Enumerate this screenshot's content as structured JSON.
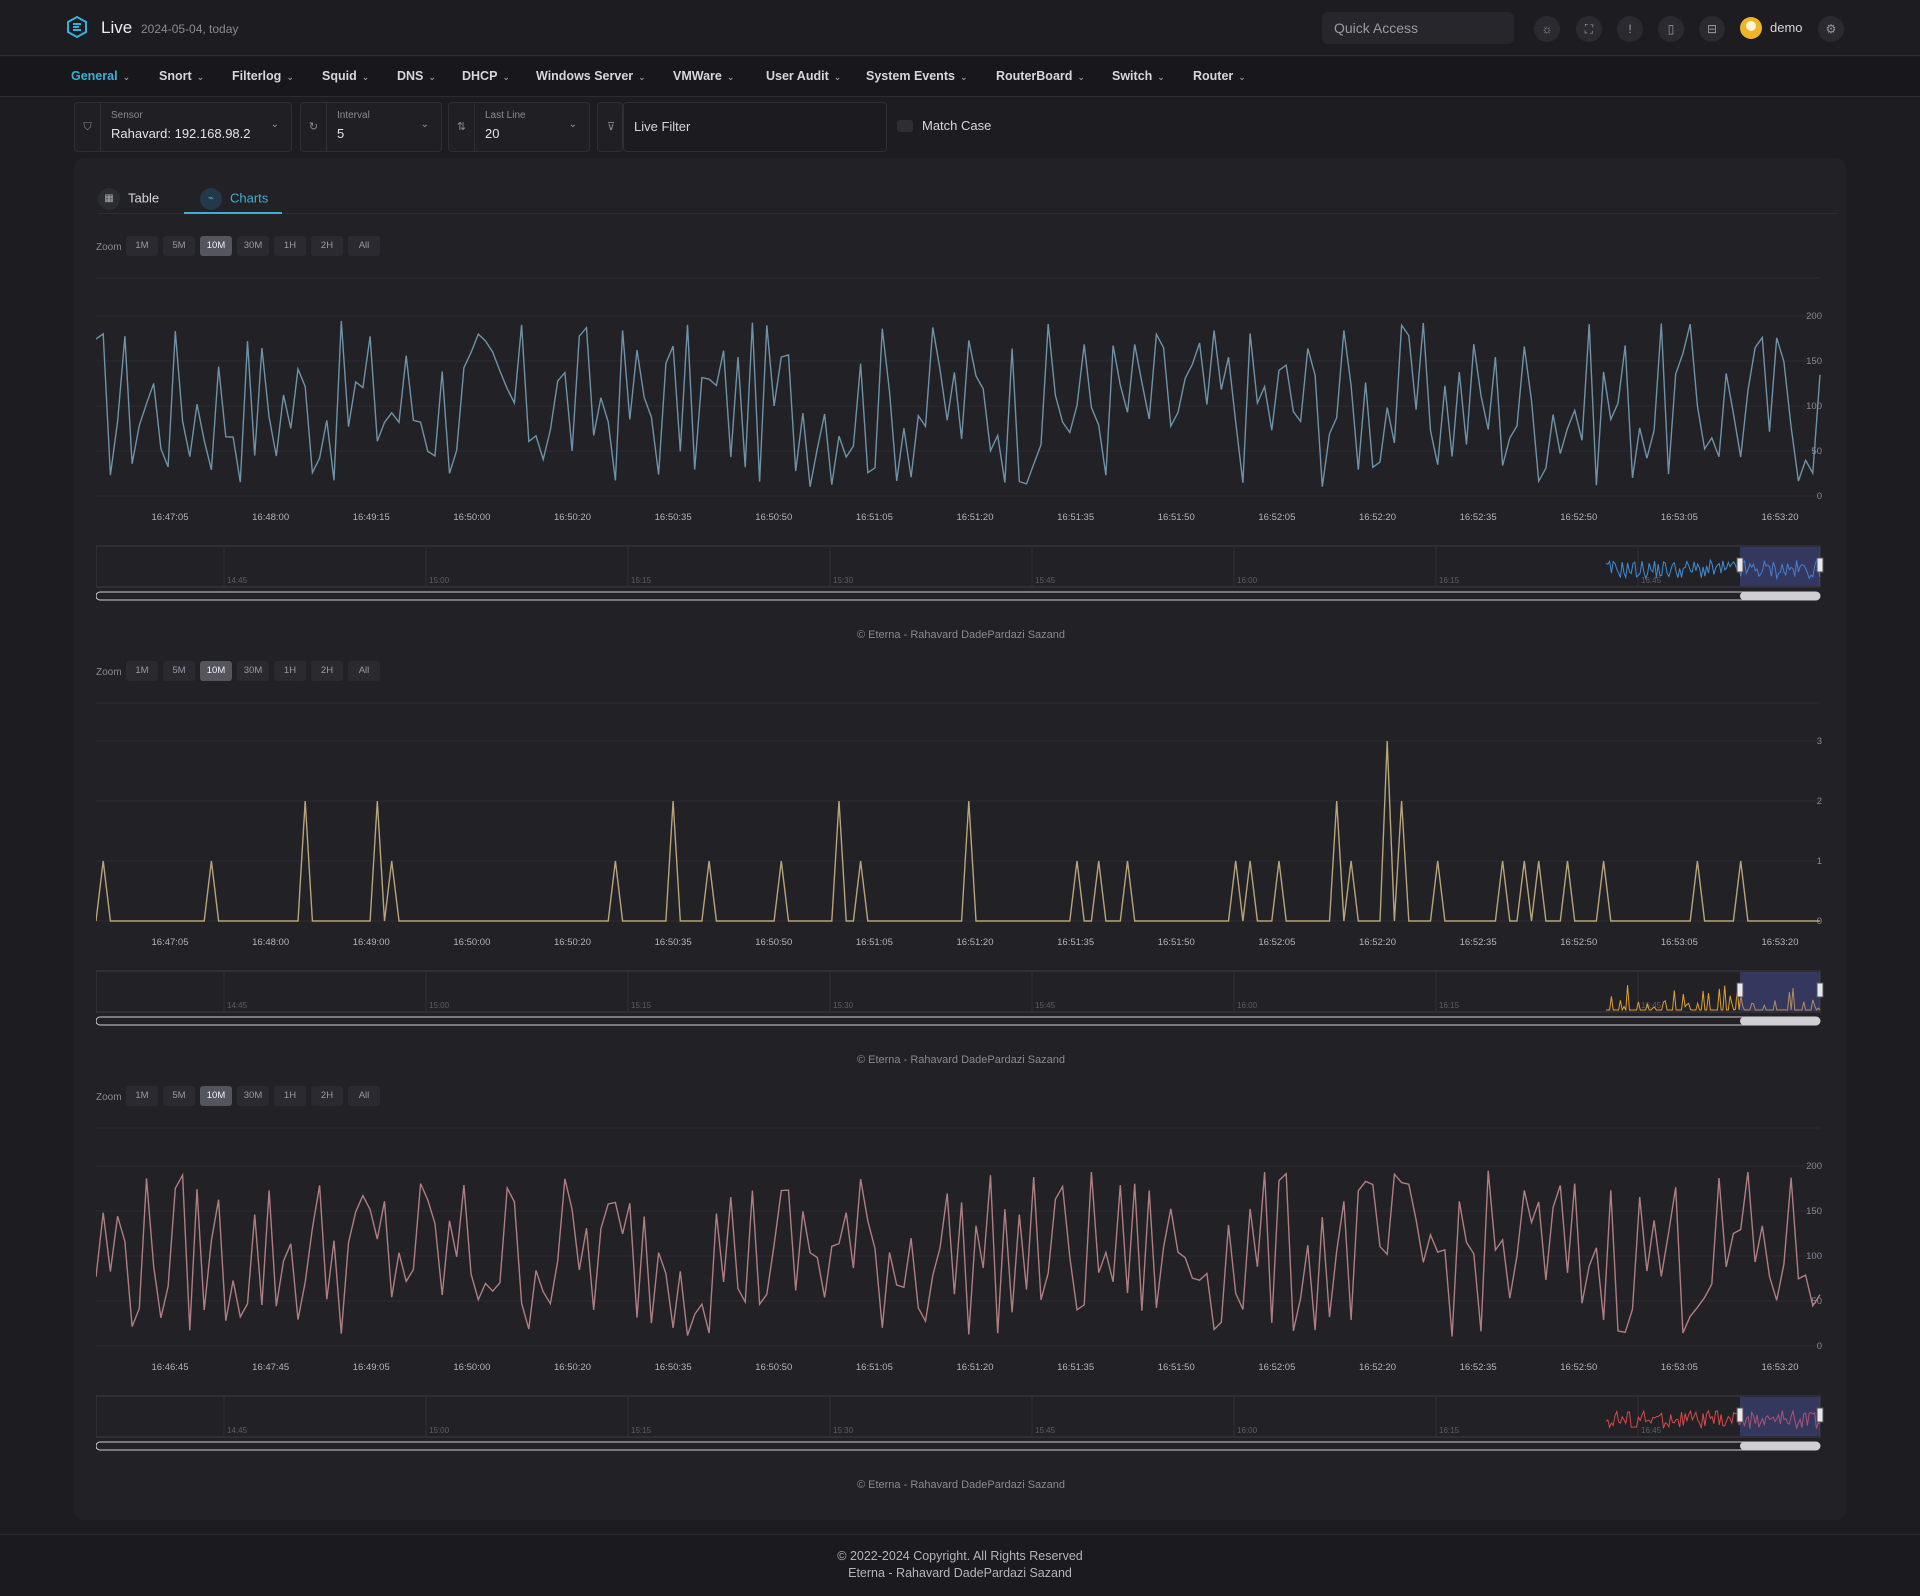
{
  "header": {
    "app_title": "Live",
    "date_text": "2024-05-04, today",
    "quick_access_placeholder": "Quick Access",
    "user_name": "demo",
    "icons": [
      "sun-icon",
      "fullscreen-icon",
      "alert-icon",
      "device-icon",
      "briefcase-icon"
    ]
  },
  "nav": {
    "items": [
      {
        "label": "General",
        "active": true
      },
      {
        "label": "Snort"
      },
      {
        "label": "Filterlog"
      },
      {
        "label": "Squid"
      },
      {
        "label": "DNS"
      },
      {
        "label": "DHCP"
      },
      {
        "label": "Windows Server"
      },
      {
        "label": "VMWare"
      },
      {
        "label": "User Audit"
      },
      {
        "label": "System Events"
      },
      {
        "label": "RouterBoard"
      },
      {
        "label": "Switch"
      },
      {
        "label": "Router"
      }
    ]
  },
  "filters": {
    "sensor": {
      "label": "Sensor",
      "value": "Rahavard: 192.168.98.2"
    },
    "interval": {
      "label": "Interval",
      "value": "5"
    },
    "last_line": {
      "label": "Last Line",
      "value": "20"
    },
    "live_filter_placeholder": "Live Filter",
    "match_case": "Match Case"
  },
  "tabs": {
    "table": "Table",
    "charts": "Charts"
  },
  "zoom": {
    "label": "Zoom",
    "buttons": [
      "1M",
      "5M",
      "10M",
      "30M",
      "1H",
      "2H",
      "All"
    ],
    "active": "10M"
  },
  "credit": "© Eterna - Rahavard DadePardazi Sazand",
  "charts": [
    {
      "color": "#6e93a8",
      "nav_color": "#3d8ed6",
      "yticks": [
        "200",
        "150",
        "100",
        "50",
        "0"
      ],
      "ymax": 200,
      "xticks": [
        "16:47:05",
        "16:48:00",
        "16:49:15",
        "16:50:00",
        "16:50:20",
        "16:50:35",
        "16:50:50",
        "16:51:05",
        "16:51:20",
        "16:51:35",
        "16:51:50",
        "16:52:05",
        "16:52:20",
        "16:52:35",
        "16:52:50",
        "16:53:05",
        "16:53:20"
      ],
      "nav_ticks": [
        "14:45",
        "15:00",
        "15:15",
        "15:30",
        "15:45",
        "16:00",
        "16:15",
        "16:45"
      ]
    },
    {
      "color": "#b8a47a",
      "nav_color": "#e0a030",
      "yticks": [
        "3",
        "2",
        "1",
        "0"
      ],
      "ymax": 3,
      "xticks": [
        "16:47:05",
        "16:48:00",
        "16:49:00",
        "16:50:00",
        "16:50:20",
        "16:50:35",
        "16:50:50",
        "16:51:05",
        "16:51:20",
        "16:51:35",
        "16:51:50",
        "16:52:05",
        "16:52:20",
        "16:52:35",
        "16:52:50",
        "16:53:05",
        "16:53:20"
      ],
      "nav_ticks": [
        "14:45",
        "15:00",
        "15:15",
        "15:30",
        "15:45",
        "16:00",
        "16:15",
        "16:45"
      ]
    },
    {
      "color": "#b07e82",
      "nav_color": "#d84a4a",
      "yticks": [
        "200",
        "150",
        "100",
        "50",
        "0"
      ],
      "ymax": 200,
      "xticks": [
        "16:46:45",
        "16:47:45",
        "16:49:05",
        "16:50:00",
        "16:50:20",
        "16:50:35",
        "16:50:50",
        "16:51:05",
        "16:51:20",
        "16:51:35",
        "16:51:50",
        "16:52:05",
        "16:52:20",
        "16:52:35",
        "16:52:50",
        "16:53:05",
        "16:53:20"
      ],
      "nav_ticks": [
        "14:45",
        "15:00",
        "15:15",
        "15:30",
        "15:45",
        "16:00",
        "16:15",
        "16:45"
      ]
    }
  ],
  "footer": {
    "line1": "© 2022-2024 Copyright. All Rights Reserved",
    "line2": "Eterna - Rahavard DadePardazi Sazand"
  }
}
